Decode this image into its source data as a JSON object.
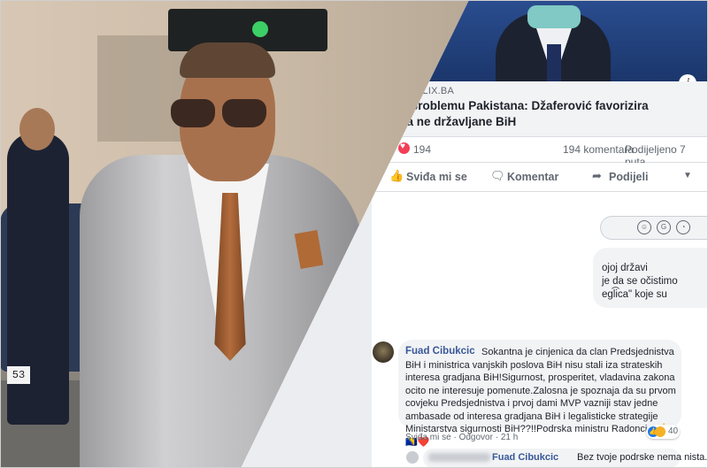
{
  "photo": {
    "plate_text": "53"
  },
  "article": {
    "domain": "KLIX.BA",
    "headline": "o problemu Pakistana: Džaferović favorizira\n, a ne državljane BiH",
    "info_icon": "info-icon"
  },
  "stats": {
    "reactions": "194",
    "comments": "194 komentara",
    "shares": "Podijeljeno 7 puta"
  },
  "actions": {
    "like": "Sviđa mi se",
    "comment": "Komentar",
    "share": "Podijeli"
  },
  "previous_comment": {
    "lines": "ojoj državi\nje da se očistimo\negl͡ica\" koje su"
  },
  "comment": {
    "author": "Fuad Cibukcic",
    "text": "Sokantna je cinjenica da clan Predsjednistva BiH i ministrica vanjskih poslova BiH nisu stali iza strateskih interesa gradjana BiH!Sigurnost, prosperitet, vladavina zakona ocito ne interesuje pomenute.Zalosna je spoznaja da su prvom covjeku Predsjednistva i prvoj dami MVP vazniji stav jedne ambasade od interesa gradjana BiH i legalisticke strategije Ministarstva sigurnosti BiH??!!Podrska ministru Radoncicu👍🇧🇦❤️",
    "like": "Sviđa mi se",
    "reply": "Odgovor",
    "time": "21 h",
    "reaction_count": "40"
  },
  "reply": {
    "mention": "Fuad Cibukcic",
    "text": "Bez tvoje podrske nema nista."
  }
}
